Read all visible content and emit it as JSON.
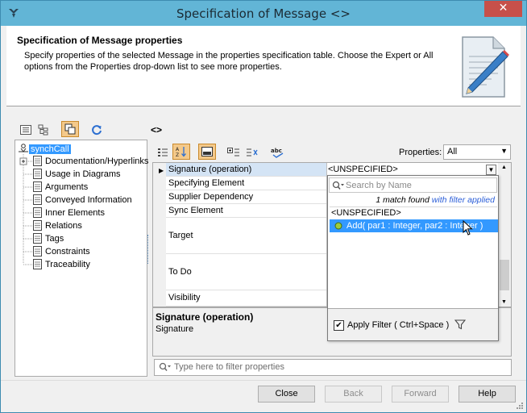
{
  "window": {
    "title": "Specification of Message <>",
    "close_glyph": "✕",
    "app_icon": "magicdraw-logo-icon"
  },
  "header": {
    "title": "Specification of Message properties",
    "description": "Specify properties of the selected Message in the properties specification table. Choose the Expert or All options from the Properties drop-down list to see more properties."
  },
  "breadcrumb": "<>",
  "tree": {
    "root": "synchCall",
    "items": [
      "Documentation/Hyperlinks",
      "Usage in Diagrams",
      "Arguments",
      "Conveyed Information",
      "Inner Elements",
      "Relations",
      "Tags",
      "Constraints",
      "Traceability"
    ]
  },
  "properties": {
    "label": "Properties:",
    "selected": "All",
    "rows": [
      "Signature (operation)",
      "Specifying Element",
      "Supplier Dependency",
      "Sync Element",
      "Target",
      "To Do",
      "Visibility"
    ],
    "signature_value": "<UNSPECIFIED>"
  },
  "description": {
    "title": "Signature (operation)",
    "text": "Signature"
  },
  "filter": {
    "placeholder": "Type here to filter properties"
  },
  "popup": {
    "search_placeholder": "Search by Name",
    "match_prefix": "1 match found",
    "match_suffix": "with filter applied",
    "option_unspecified": "<UNSPECIFIED>",
    "option_add": "Add( par1 : Integer, par2 : Integer )",
    "apply_filter_label": "Apply Filter ( Ctrl+Space )",
    "apply_filter_checked": true
  },
  "buttons": {
    "close": "Close",
    "back": "Back",
    "forward": "Forward",
    "help": "Help"
  },
  "colors": {
    "titlebar": "#62b5d6",
    "selection": "#3399ff",
    "close_button": "#c7504a",
    "link_blue": "#2b5ed8"
  }
}
